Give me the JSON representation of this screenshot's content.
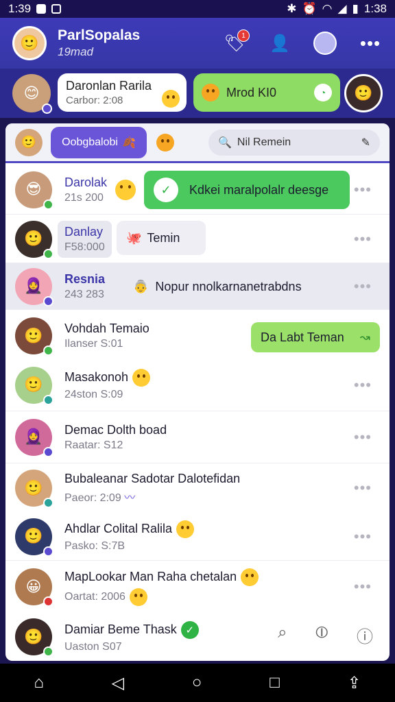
{
  "status": {
    "time_left": "1:39",
    "time_right": "1:38"
  },
  "header": {
    "name": "ParlSopalas",
    "subtitle": "19mad",
    "notification_count": "1"
  },
  "pinned": [
    {
      "name": "Daronlan Rarila",
      "sub": "Carbor: 2:08"
    },
    {
      "name": "Mrod KI0",
      "sub": ""
    }
  ],
  "search": {
    "chip_label": "Oobgbalobi",
    "placeholder": "Nil Remein"
  },
  "chats": [
    {
      "name": "Darolak",
      "sub": "21s 200",
      "bubble": "Kdkei maralpolalr deesge"
    },
    {
      "name": "Danlay",
      "sub": "F58:000",
      "bubble": "Temin"
    },
    {
      "name": "Resnia",
      "sub": "243 283",
      "bubble": "Nopur nnolkarnanetrabdns"
    },
    {
      "name": "Vohdah Temaio",
      "sub": "Ilanser S:01",
      "bubble": "Da Labt Teman"
    },
    {
      "name": "Masakonoh",
      "sub": "24ston S:09"
    },
    {
      "name": "Demac Dolth boad",
      "sub": "Raatar: S12"
    },
    {
      "name": "Bubaleanar Sadotar Dalotefidan",
      "sub": "Paeor: 2:09"
    },
    {
      "name": "Ahdlar Colital Ralila",
      "sub": "Pasko: S:7B"
    },
    {
      "name": "MapLookar Man Raha chetalan",
      "sub": "Oartat: 2006"
    },
    {
      "name": "Damiar Beme Thask",
      "sub": "Uaston S07"
    }
  ],
  "colors": {
    "header": "#3e3ab8",
    "accent": "#6a54d8",
    "green": "#7ed957"
  }
}
